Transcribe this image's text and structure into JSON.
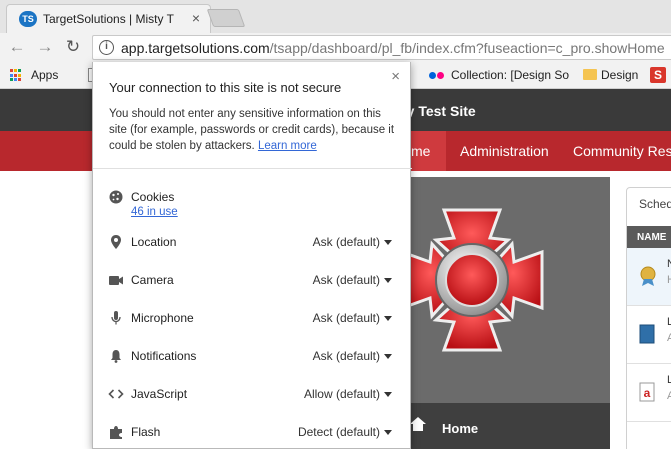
{
  "browser": {
    "tab": {
      "title": "TargetSolutions | Misty T",
      "favicon_text": "TS"
    },
    "url": {
      "host": "app.targetsolutions.com",
      "path": "/tsapp/dashboard/pl_fb/index.cfm?fuseaction=c_pro.showHome"
    },
    "nav": {
      "back": "←",
      "forward": "→",
      "reload": "↻"
    }
  },
  "bookmarks": {
    "apps_label": "Apps",
    "collection_label": "Collection: [Design So",
    "design_label": "Design",
    "s_icon_text": "S"
  },
  "site": {
    "header_title": "ty Test Site",
    "nav": {
      "home": "me",
      "administration": "Administration",
      "community": "Community Reso"
    },
    "hero_home_label": "Home",
    "panel": {
      "title": "Sched",
      "column_header": "NAME",
      "rows": [
        {
          "letter": "N",
          "sub": "H"
        },
        {
          "letter": "L",
          "sub": "A"
        },
        {
          "letter": "L",
          "sub": "A"
        }
      ]
    }
  },
  "popup": {
    "close_glyph": "×",
    "heading": "Your connection to this site is not secure",
    "body": "You should not enter any sensitive information on this site (for example, passwords or credit cards), because it could be stolen by attackers.",
    "learn_more": "Learn more",
    "cookies": {
      "label": "Cookies",
      "link": "46 in use"
    },
    "permissions": [
      {
        "name": "location",
        "icon": "location-pin-icon",
        "label": "Location",
        "value": "Ask (default)"
      },
      {
        "name": "camera",
        "icon": "camera-icon",
        "label": "Camera",
        "value": "Ask (default)"
      },
      {
        "name": "microphone",
        "icon": "microphone-icon",
        "label": "Microphone",
        "value": "Ask (default)"
      },
      {
        "name": "notifications",
        "icon": "bell-icon",
        "label": "Notifications",
        "value": "Ask (default)"
      },
      {
        "name": "javascript",
        "icon": "code-icon",
        "label": "JavaScript",
        "value": "Allow (default)"
      },
      {
        "name": "flash",
        "icon": "puzzle-icon",
        "label": "Flash",
        "value": "Detect (default)"
      }
    ]
  },
  "colors": {
    "site_nav_red": "#b8282d",
    "site_header_dark": "#3a3a3a",
    "link_blue": "#3367d6",
    "hero_gray": "#6b6b6b"
  }
}
